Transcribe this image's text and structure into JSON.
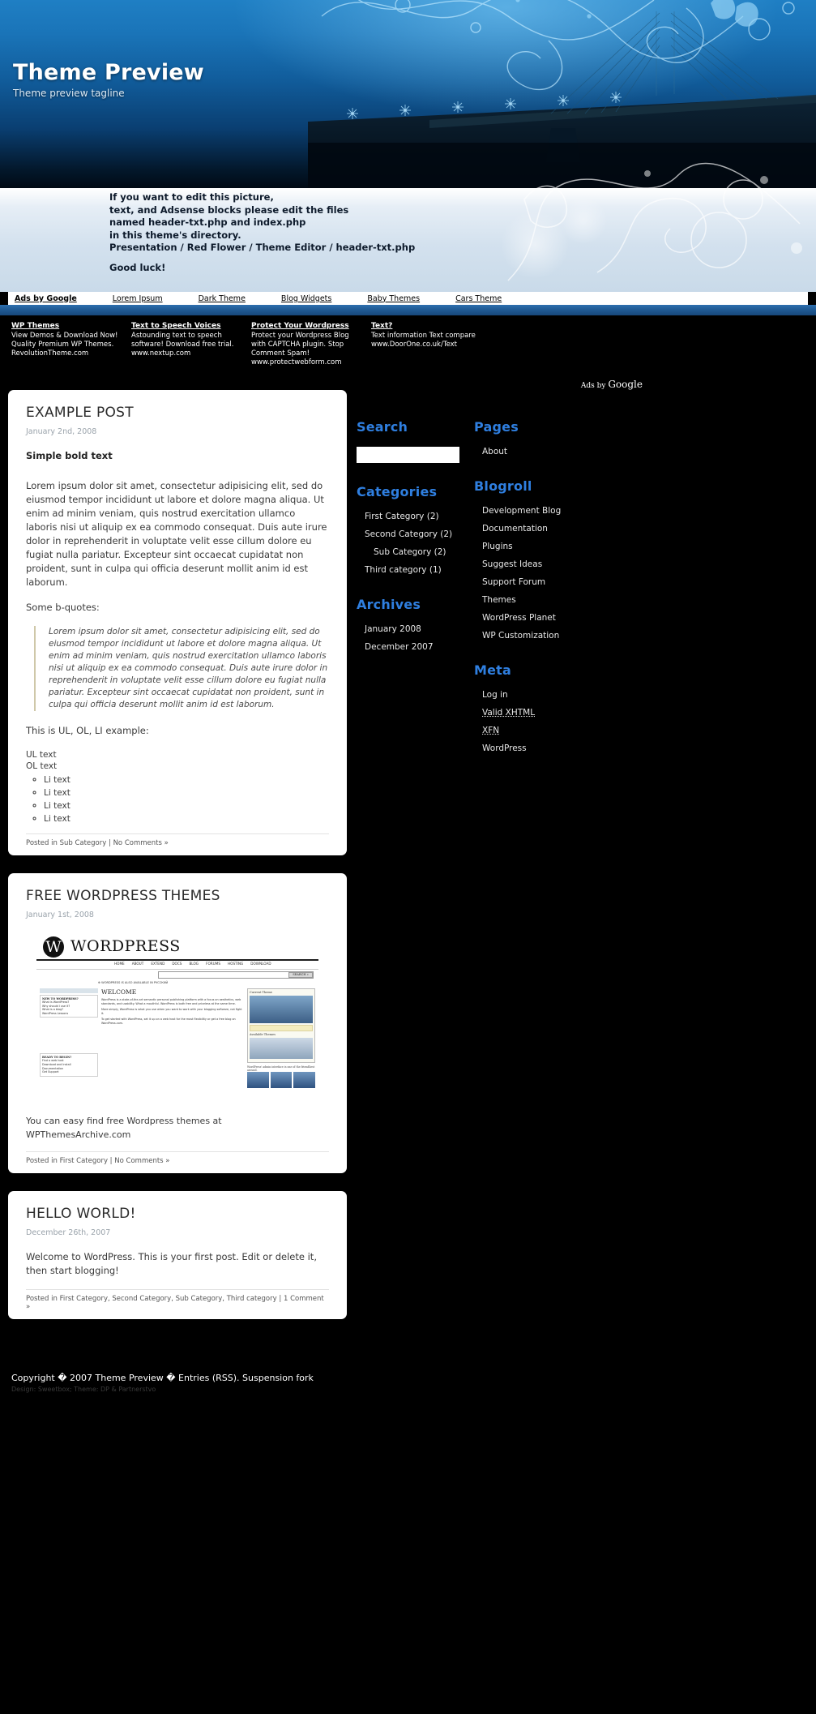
{
  "banner": {
    "title": "Theme Preview",
    "tagline": "Theme preview tagline",
    "edit_note_lines": [
      "If you want to edit this picture,",
      "text, and Adsense blocks please edit the files",
      "named header-txt.php and index.php",
      "in this theme's directory.",
      "Presentation / Red Flower / Theme Editor / header-txt.php"
    ],
    "good_luck": "Good luck!"
  },
  "adlinks": {
    "label": "Ads by Google",
    "items": [
      "Lorem Ipsum",
      "Dark Theme",
      "Blog Widgets",
      "Baby Themes",
      "Cars Theme"
    ]
  },
  "adblocks": [
    {
      "title": "WP Themes",
      "line1": "View Demos & Download Now!",
      "line2": "Quality Premium WP Themes.",
      "line3": "RevolutionTheme.com"
    },
    {
      "title": "Text to Speech Voices",
      "line1": "Astounding text to speech",
      "line2": "software! Download free trial.",
      "line3": "www.nextup.com"
    },
    {
      "title": "Protect Your Wordpress",
      "line1": "Protect your Wordpress Blog",
      "line2": "with CAPTCHA plugin. Stop",
      "line3": "Comment Spam!",
      "line4": "www.protectwebform.com"
    },
    {
      "title": "Text?",
      "line1": "Text information Text compare",
      "line2": "www.DoorOne.co.uk/Text",
      "line3": "",
      "line4": ""
    }
  ],
  "adsby_right": {
    "prefix": "Ads by ",
    "brand": "Google"
  },
  "posts": [
    {
      "title": "EXAMPLE POST",
      "date": "January 2nd, 2008",
      "bold_text": "Simple bold text",
      "body": "Lorem ipsum dolor sit amet, consectetur adipisicing elit, sed do eiusmod tempor incididunt ut labore et dolore magna aliqua. Ut enim ad minim veniam, quis nostrud exercitation ullamco laboris nisi ut aliquip ex ea commodo consequat. Duis aute irure dolor in reprehenderit in voluptate velit esse cillum dolore eu fugiat nulla pariatur. Excepteur sint occaecat cupidatat non proident, sunt in culpa qui officia deserunt mollit anim id est laborum.",
      "bq_intro": "Some b-quotes:",
      "blockquote": "Lorem ipsum dolor sit amet, consectetur adipisicing elit, sed do eiusmod tempor incididunt ut labore et dolore magna aliqua. Ut enim ad minim veniam, quis nostrud exercitation ullamco laboris nisi ut aliquip ex ea commodo consequat. Duis aute irure dolor in reprehenderit in voluptate velit esse cillum dolore eu fugiat nulla pariatur. Excepteur sint occaecat cupidatat non proident, sunt in culpa qui officia deserunt mollit anim id est laborum.",
      "list_intro": "This is UL, OL, LI example:",
      "ul_text": "UL text",
      "ol_text": "OL text",
      "li_items": [
        "Li text",
        "Li text",
        "Li text",
        "Li text"
      ],
      "meta_prefix": "Posted in ",
      "meta_cats": "Sub Category",
      "meta_sep": " | ",
      "meta_comments": "No Comments »"
    },
    {
      "title": "FREE WORDPRESS THEMES",
      "date": "January 1st, 2008",
      "free_text": "You can easy find free Wordpress themes at WPThemesArchive.com",
      "meta_prefix": "Posted in ",
      "meta_cats": "First Category",
      "meta_sep": " | ",
      "meta_comments": "No Comments »"
    },
    {
      "title": "HELLO WORLD!",
      "date": "December 26th, 2007",
      "body": "Welcome to WordPress. This is your first post. Edit or delete it, then start blogging!",
      "meta_prefix": "Posted in ",
      "meta_cats": "First Category, Second Category, Sub Category, Third category",
      "meta_sep": " | ",
      "meta_comments": "1 Comment »"
    }
  ],
  "wp_shot": {
    "wordmark": "WORDPRESS",
    "logo_glyph": "W",
    "nav": [
      "HOME",
      "ABOUT",
      "EXTEND",
      "DOCS",
      "BLOG",
      "FORUMS",
      "HOSTING",
      "DOWNLOAD"
    ],
    "search_button": "SEARCH »",
    "notice": "⊕ WORDPRESS IS ALSO AVAILABLE IN РУССКИЙ",
    "welcome": "WELCOME",
    "welcome_body": "WordPress is a state-of-the-art semantic personal publishing platform with a focus on aesthetics, web standards, and usability. What a mouthful. WordPress is both free and priceless at the same time.",
    "welcome_body2": "More simply, WordPress is what you use when you want to work with your blogging software, not fight it.",
    "welcome_body3": "To get started with WordPress, set it up on a web host for the most flexibility or get a free blog on WordPress.com.",
    "left_title1": "NEW TO WORDPRESS?",
    "left_items1": [
      "What is WordPress?",
      "Why should I use it?",
      "What is a blog?",
      "WordPress Lessons"
    ],
    "left_title2": "READY TO BEGIN?",
    "left_items2": [
      "Find a web host",
      "Download and Install",
      "Documentation",
      "Get Support"
    ],
    "right_title": "Current Theme",
    "right_sub": "Available Themes",
    "right_caption": "WordPress' admin interface is one of the friendliest around."
  },
  "sidebar_left": {
    "search": {
      "heading": "Search",
      "value": "",
      "placeholder": ""
    },
    "categories": {
      "heading": "Categories",
      "items": [
        {
          "label": "First Category (2)",
          "sub": false
        },
        {
          "label": "Second Category (2)",
          "sub": false
        },
        {
          "label": "Sub Category (2)",
          "sub": true
        },
        {
          "label": "Third category (1)",
          "sub": false
        }
      ]
    },
    "archives": {
      "heading": "Archives",
      "items": [
        "January 2008",
        "December 2007"
      ]
    }
  },
  "sidebar_right": {
    "pages": {
      "heading": "Pages",
      "items": [
        "About"
      ]
    },
    "blogroll": {
      "heading": "Blogroll",
      "items": [
        "Development Blog",
        "Documentation",
        "Plugins",
        "Suggest Ideas",
        "Support Forum",
        "Themes",
        "WordPress Planet",
        "WP Customization"
      ]
    },
    "meta": {
      "heading": "Meta",
      "items": [
        "Log in",
        "Valid XHTML",
        "XFN",
        "WordPress"
      ]
    }
  },
  "footer": {
    "line1": "Copyright � 2007 Theme Preview � Entries (RSS). Suspension fork",
    "line2": "Design: Sweetbox; Theme: DP & Partnerstvo"
  },
  "colors": {
    "accent_blue": "#2f7fe0",
    "banner_blue": "#1a74b8",
    "rule_blue": "#215c97",
    "page_bg": "#000000",
    "card_bg": "#ffffff"
  }
}
